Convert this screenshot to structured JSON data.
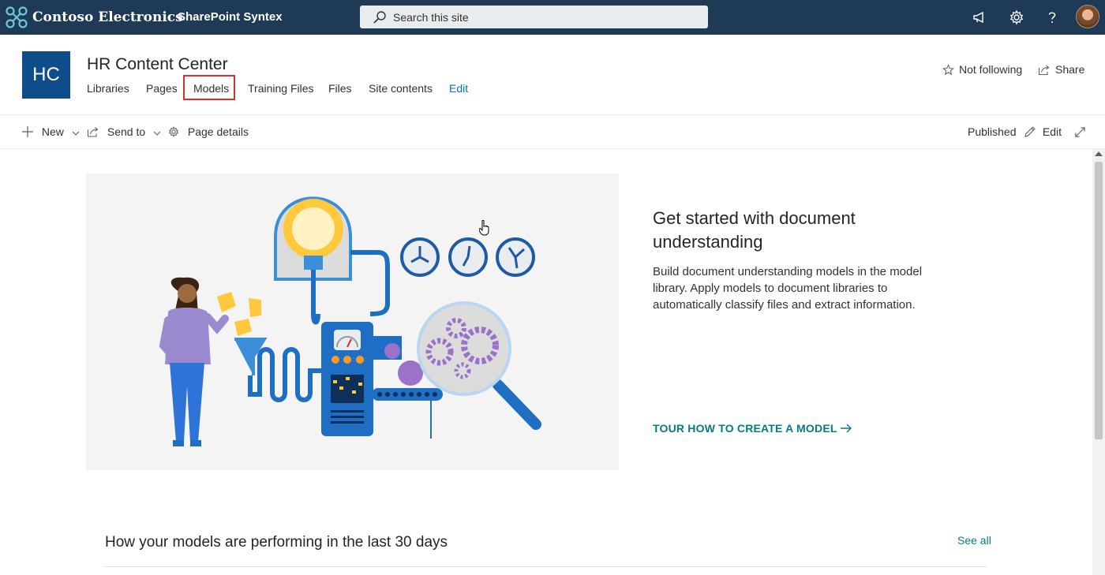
{
  "suite_bar": {
    "org_name": "Contoso Electronics",
    "app_name": "SharePoint Syntex",
    "search_placeholder": "Search this site",
    "icons": [
      "megaphone-icon",
      "gear-icon",
      "help-icon",
      "avatar"
    ]
  },
  "site": {
    "logo_initials": "HC",
    "title": "HR Content Center",
    "nav": [
      "Libraries",
      "Pages",
      "Models",
      "Training Files",
      "Files",
      "Site contents",
      "Edit"
    ],
    "highlighted_nav": "Models",
    "follow_label": "Not following",
    "share_label": "Share"
  },
  "command_bar": {
    "new_label": "New",
    "send_to_label": "Send to",
    "page_details_label": "Page details",
    "status": "Published",
    "edit_label": "Edit"
  },
  "hero": {
    "title": "Get started with document understanding",
    "description": "Build document understanding models in the model library. Apply models to document libraries to automatically classify files and extract information.",
    "link_label": "TOUR HOW TO CREATE A MODEL"
  },
  "performance": {
    "title": "How your models are performing in the last 30 days",
    "see_all_label": "See all"
  },
  "colors": {
    "suite_bar_bg": "#1e3a56",
    "site_tile": "#0f4c8a",
    "accent_teal": "#037b86",
    "highlight_box": "#d9302c"
  }
}
